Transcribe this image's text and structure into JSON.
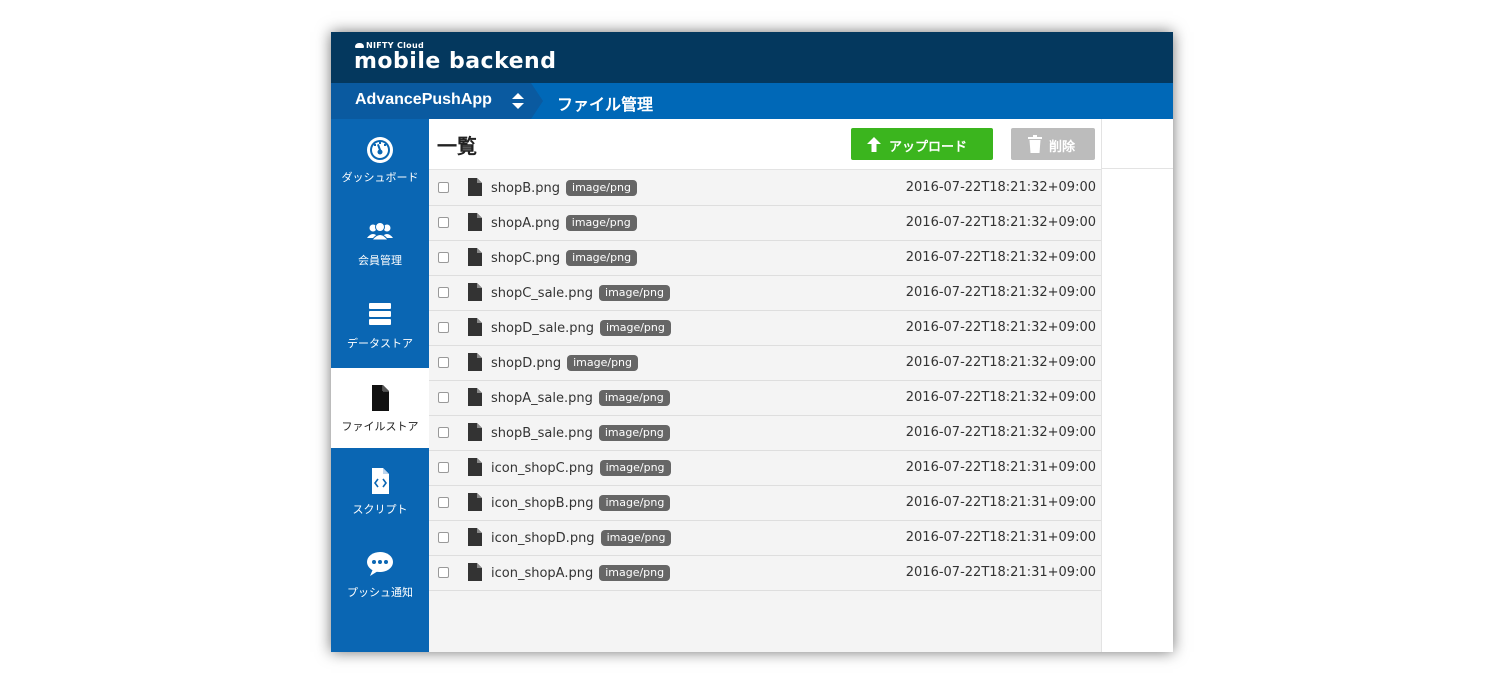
{
  "header": {
    "brand_small": "NIFTY Cloud",
    "brand_main": "mobile backend",
    "app_name": "AdvancePushApp",
    "page_title": "ファイル管理"
  },
  "sidebar": {
    "items": [
      {
        "label": "ダッシュボード",
        "icon": "dashboard-icon",
        "active": false
      },
      {
        "label": "会員管理",
        "icon": "users-icon",
        "active": false
      },
      {
        "label": "データストア",
        "icon": "database-icon",
        "active": false
      },
      {
        "label": "ファイルストア",
        "icon": "file-icon",
        "active": true
      },
      {
        "label": "スクリプト",
        "icon": "script-icon",
        "active": false
      },
      {
        "label": "プッシュ通知",
        "icon": "chat-bubble-icon",
        "active": false
      }
    ]
  },
  "content": {
    "list_title": "一覧",
    "upload_label": "アップロード",
    "delete_label": "削除",
    "accent_upload": "#3bb51e",
    "accent_delete": "#bcbcbc",
    "files": [
      {
        "name": "shopB.png",
        "type": "image/png",
        "date": "2016-07-22T18:21:32+09:00"
      },
      {
        "name": "shopA.png",
        "type": "image/png",
        "date": "2016-07-22T18:21:32+09:00"
      },
      {
        "name": "shopC.png",
        "type": "image/png",
        "date": "2016-07-22T18:21:32+09:00"
      },
      {
        "name": "shopC_sale.png",
        "type": "image/png",
        "date": "2016-07-22T18:21:32+09:00"
      },
      {
        "name": "shopD_sale.png",
        "type": "image/png",
        "date": "2016-07-22T18:21:32+09:00"
      },
      {
        "name": "shopD.png",
        "type": "image/png",
        "date": "2016-07-22T18:21:32+09:00"
      },
      {
        "name": "shopA_sale.png",
        "type": "image/png",
        "date": "2016-07-22T18:21:32+09:00"
      },
      {
        "name": "shopB_sale.png",
        "type": "image/png",
        "date": "2016-07-22T18:21:32+09:00"
      },
      {
        "name": "icon_shopC.png",
        "type": "image/png",
        "date": "2016-07-22T18:21:31+09:00"
      },
      {
        "name": "icon_shopB.png",
        "type": "image/png",
        "date": "2016-07-22T18:21:31+09:00"
      },
      {
        "name": "icon_shopD.png",
        "type": "image/png",
        "date": "2016-07-22T18:21:31+09:00"
      },
      {
        "name": "icon_shopA.png",
        "type": "image/png",
        "date": "2016-07-22T18:21:31+09:00"
      }
    ]
  }
}
